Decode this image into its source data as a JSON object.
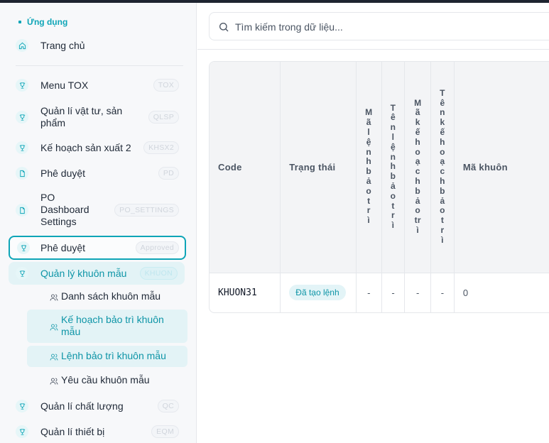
{
  "sidebar": {
    "section_label": "Ứng dụng",
    "home": {
      "label": "Trang chủ"
    },
    "items": [
      {
        "label": "Menu TOX",
        "badge": "TOX"
      },
      {
        "label_lines": [
          "Quản lí vật tư, sản",
          "phẩm"
        ],
        "badge": "QLSP"
      },
      {
        "label": "Kế hoạch sản xuất 2",
        "badge": "KHSX2"
      },
      {
        "label": "Phê duyệt",
        "badge": "PD"
      },
      {
        "label_lines": [
          "PO",
          "Dashboard",
          "Settings"
        ],
        "badge": "PO_SETTINGS"
      },
      {
        "label": "Phê duyệt",
        "badge": "Approved"
      },
      {
        "label": "Quản lý khuôn mẫu",
        "badge": "KHUON"
      },
      {
        "label": "Quản lí chất lượng",
        "badge": "QC"
      },
      {
        "label": "Quản lí thiết bị",
        "badge": "EQM"
      }
    ],
    "subitems": [
      {
        "label": "Danh sách khuôn mẫu"
      },
      {
        "label_lines": [
          "Kế hoạch bảo trì khuôn",
          "mẫu"
        ]
      },
      {
        "label": "Lệnh bảo trì khuôn mẫu"
      },
      {
        "label": "Yêu cầu khuôn mẫu"
      }
    ]
  },
  "search": {
    "placeholder": "Tìm kiếm trong dữ liệu..."
  },
  "table": {
    "headers": [
      "Code",
      "Trạng thái",
      "Mã lệnh bảo trì",
      "Tên lệnh bảo trì",
      "Mã kế hoạch bảo trì",
      "Tên kế hoạch bảo trì",
      "Mã khuôn"
    ],
    "vertical_headers": [
      [
        "M",
        "ã",
        "l",
        "ệ",
        "n",
        "h",
        "b",
        "ả",
        "o",
        "t",
        "r",
        "ì"
      ],
      [
        "T",
        "ê",
        "n",
        "l",
        "ệ",
        "n",
        "h",
        "b",
        "ả",
        "o",
        "t",
        "r",
        "ì"
      ],
      [
        "M",
        "ã",
        "k",
        "ế",
        "h",
        "o",
        "ạ",
        "c",
        "h",
        "b",
        "ả",
        "o",
        "tr",
        "ì"
      ],
      [
        "T",
        "ê",
        "n",
        "k",
        "ế",
        "h",
        "o",
        "ạ",
        "c",
        "h",
        "b",
        "ả",
        "o",
        "t",
        "r",
        "ì"
      ]
    ],
    "rows": [
      {
        "code": "KHUON31",
        "status": "Đã tạo lệnh",
        "ma_lenh": "-",
        "ten_lenh": "-",
        "ma_kh": "-",
        "ten_kh": "-",
        "ma_khuon": "0"
      }
    ]
  }
}
